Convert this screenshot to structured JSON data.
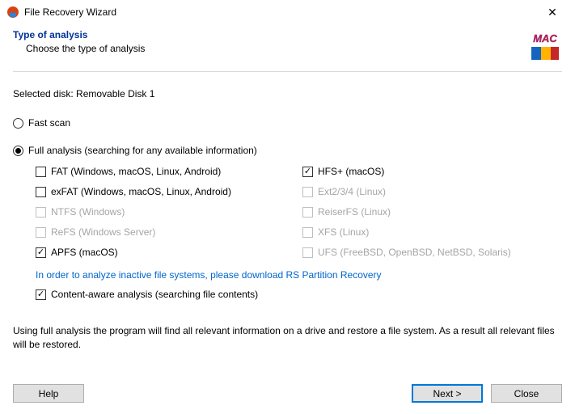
{
  "titlebar": {
    "title": "File Recovery Wizard"
  },
  "header": {
    "heading": "Type of analysis",
    "sub": "Choose the type of analysis"
  },
  "selected_disk_label": "Selected disk: Removable Disk 1",
  "scan_modes": {
    "fast": "Fast scan",
    "full": "Full analysis (searching for any available information)"
  },
  "filesystems": {
    "fat": {
      "label": "FAT (Windows, macOS, Linux, Android)",
      "checked": false,
      "enabled": true
    },
    "hfs": {
      "label": "HFS+ (macOS)",
      "checked": true,
      "enabled": true
    },
    "exfat": {
      "label": "exFAT (Windows, macOS, Linux, Android)",
      "checked": false,
      "enabled": true
    },
    "ext": {
      "label": "Ext2/3/4 (Linux)",
      "checked": false,
      "enabled": false
    },
    "ntfs": {
      "label": "NTFS (Windows)",
      "checked": false,
      "enabled": false
    },
    "reiser": {
      "label": "ReiserFS (Linux)",
      "checked": false,
      "enabled": false
    },
    "refs": {
      "label": "ReFS (Windows Server)",
      "checked": false,
      "enabled": false
    },
    "xfs": {
      "label": "XFS (Linux)",
      "checked": false,
      "enabled": false
    },
    "apfs": {
      "label": "APFS (macOS)",
      "checked": true,
      "enabled": true
    },
    "ufs": {
      "label": "UFS (FreeBSD, OpenBSD, NetBSD, Solaris)",
      "checked": false,
      "enabled": false
    }
  },
  "link": "In order to analyze inactive file systems, please download RS Partition Recovery",
  "content_aware": {
    "label": "Content-aware analysis (searching file contents)",
    "checked": true
  },
  "description": "Using full analysis the program will find all relevant information on a drive and restore a file system. As a result all relevant files will be restored.",
  "buttons": {
    "help": "Help",
    "next": "Next >",
    "close": "Close"
  }
}
